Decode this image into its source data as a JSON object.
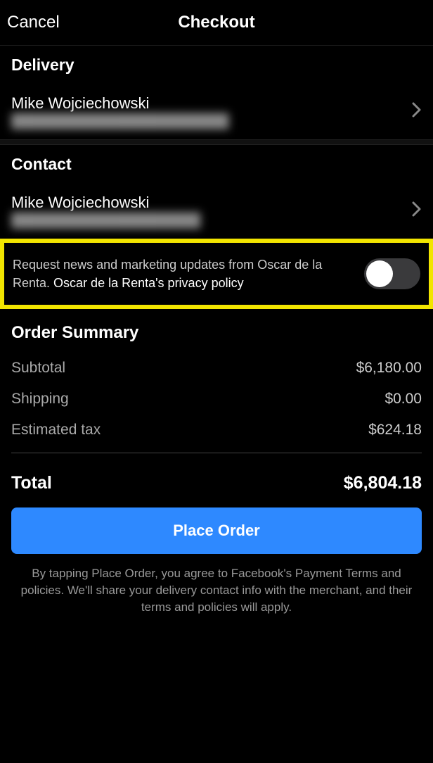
{
  "header": {
    "cancel": "Cancel",
    "title": "Checkout"
  },
  "delivery": {
    "title": "Delivery",
    "name": "Mike Wojciechowski",
    "address": "███████████████████████"
  },
  "contact": {
    "title": "Contact",
    "name": "Mike Wojciechowski",
    "email": "████████████████████"
  },
  "marketing": {
    "text_prefix": "Request news and marketing updates from Oscar de la Renta. ",
    "privacy_label": "Oscar de la Renta's privacy policy",
    "toggle_on": false
  },
  "summary": {
    "title": "Order Summary",
    "rows": [
      {
        "label": "Subtotal",
        "value": "$6,180.00"
      },
      {
        "label": "Shipping",
        "value": "$0.00"
      },
      {
        "label": "Estimated tax",
        "value": "$624.18"
      }
    ],
    "total_label": "Total",
    "total_value": "$6,804.18"
  },
  "footer": {
    "place_order": "Place Order",
    "legal": "By tapping Place Order, you agree to Facebook's Payment Terms and policies. We'll share your delivery contact info with the merchant, and their terms and policies will apply."
  }
}
